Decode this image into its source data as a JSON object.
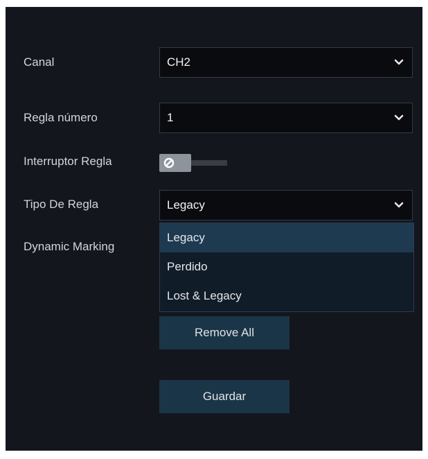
{
  "form": {
    "channel": {
      "label": "Canal",
      "value": "CH2"
    },
    "rule_number": {
      "label": "Regla número",
      "value": "1"
    },
    "rule_switch": {
      "label": "Interruptor Regla",
      "state": "off",
      "icon": "ban-icon"
    },
    "rule_type": {
      "label": "Tipo De Regla",
      "value": "Legacy",
      "options": [
        "Legacy",
        "Perdido",
        "Lost & Legacy"
      ],
      "highlighted_index": 0
    },
    "dynamic_marking": {
      "label": "Dynamic Marking"
    }
  },
  "buttons": {
    "remove_all": "Remove All",
    "save": "Guardar"
  },
  "colors": {
    "background": "#13161d",
    "select_bg": "#0a0b0e",
    "button_bg": "#1b3548",
    "highlight": "#1d3a50",
    "dropdown_bg": "#111c29"
  },
  "icons": {
    "chevron": "chevron-down-icon",
    "toggle": "ban-icon"
  }
}
